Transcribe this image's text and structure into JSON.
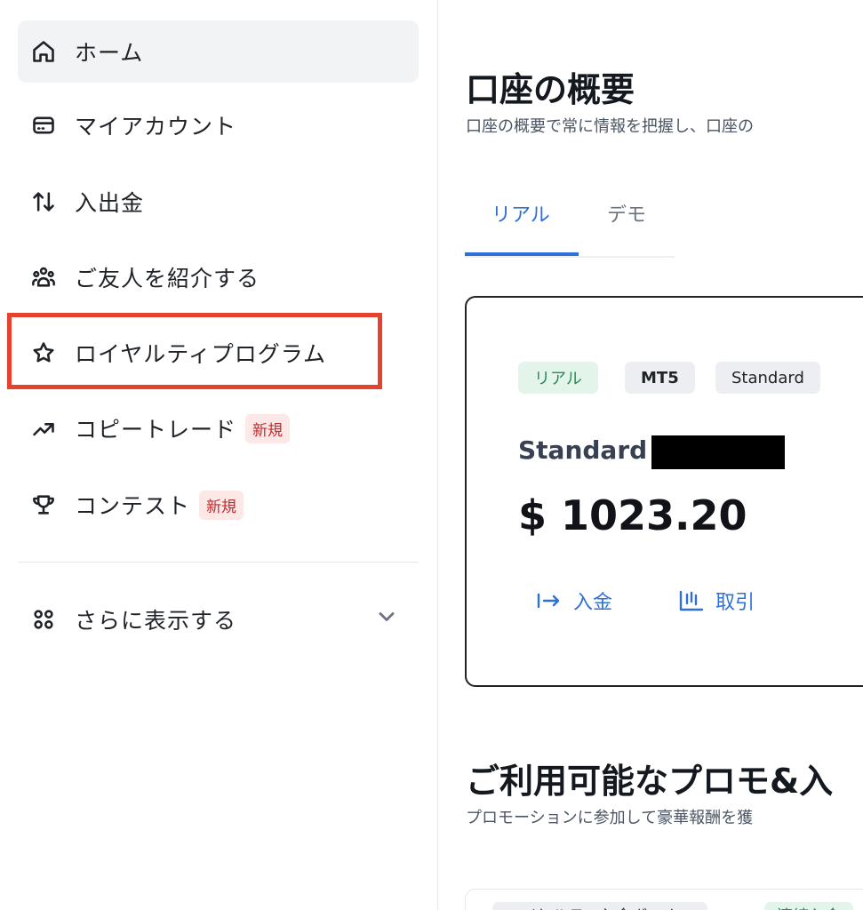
{
  "sidebar": {
    "items": [
      {
        "label": "ホーム",
        "icon": "home-icon"
      },
      {
        "label": "マイアカウント",
        "icon": "card-icon"
      },
      {
        "label": "入出金",
        "icon": "transfer-arrows-icon"
      },
      {
        "label": "ご友人を紹介する",
        "icon": "users-icon"
      },
      {
        "label": "ロイヤルティプログラム",
        "icon": "star-icon"
      },
      {
        "label": "コピートレード",
        "icon": "trending-up-icon",
        "badge": "新規"
      },
      {
        "label": "コンテスト",
        "icon": "trophy-icon",
        "badge": "新規"
      }
    ],
    "more": {
      "label": "さらに表示する",
      "icon": "grid-icon"
    }
  },
  "main": {
    "title": "口座の概要",
    "subtitle": "口座の概要で常に情報を把握し、口座の",
    "tabs": [
      {
        "label": "リアル",
        "active": true
      },
      {
        "label": "デモ",
        "active": false
      }
    ],
    "account": {
      "tags": [
        "リアル",
        "MT5",
        "Standard"
      ],
      "name": "Standard",
      "balance": "$ 1023.20",
      "actions": [
        {
          "label": "入金",
          "icon": "deposit-arrow-icon"
        },
        {
          "label": "取引",
          "icon": "candlestick-chart-icon"
        }
      ]
    },
    "promo": {
      "title": "ご利用可能なプロモ&入",
      "subtitle": "プロモーションに参加して豪華報酬を獲",
      "tags": [
        "ロイヤルティ入金ボーナス",
        "連続入金"
      ]
    }
  },
  "colors": {
    "accent": "#2f6fd8",
    "highlight_box": "#e5432e",
    "badge_new_bg": "#fde8e8",
    "badge_new_text": "#c02b2b",
    "real_tag_bg": "#e3f4ea",
    "real_tag_text": "#2e8a55"
  }
}
